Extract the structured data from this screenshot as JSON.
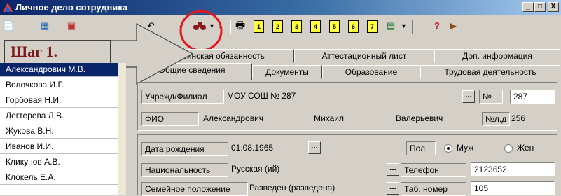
{
  "window": {
    "title": "Личное дело сотрудника",
    "minimize": "_",
    "maximize": "□",
    "close": "X"
  },
  "callout": {
    "text": "Шаг 1."
  },
  "employees": [
    "Александрович М.В.",
    "Волочкова И.Г.",
    "Горбовая Н.И.",
    "Дегтерева Л.В.",
    "Жукова В.Н.",
    "Иванов И.И.",
    "Кликунов А.В.",
    "Клокель Е.А."
  ],
  "tabs_row1": [
    "Воинская обязанность",
    "Аттестационный лист",
    "Доп. информация"
  ],
  "tabs_row2": [
    "Общие сведения",
    "Документы",
    "Образование",
    "Трудовая деятельность"
  ],
  "toolbar": {
    "doc_buttons": [
      "1",
      "2",
      "3",
      "4",
      "5",
      "6",
      "7"
    ],
    "help": "?"
  },
  "form": {
    "branch_label": "Учрежд/Филиал",
    "branch_value": "МОУ СОШ № 287",
    "number_label": "№",
    "number_value": "287",
    "fio_label": "ФИО",
    "last_name": "Александрович",
    "first_name": "Михаил",
    "patronymic": "Валерьевич",
    "file_no_label": "№л.д",
    "file_no_value": "256",
    "birth_label": "Дата рождения",
    "birth_value": "01.08.1965",
    "sex_label": "Пол",
    "sex_male": "Муж",
    "sex_female": "Жен",
    "nationality_label": "Национальность",
    "nationality_value": "Русская (ий)",
    "phone_label": "Телефон",
    "phone_value": "2123652",
    "marital_label": "Семейное положение",
    "marital_value": "Разведен (разведена)",
    "tab_no_label": "Таб. номер",
    "tab_no_value": "105",
    "dots": "..."
  },
  "colors": {
    "title_start": "#0a246a",
    "selection": "#0a246a",
    "highlight_circle": "#e8141c",
    "callout_text": "#7a1a1a"
  }
}
